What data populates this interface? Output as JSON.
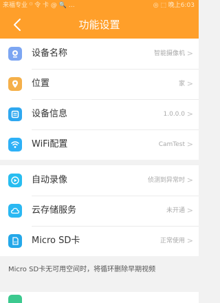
{
  "status_bar": {
    "left": "来福专业 ⁽⁾ 令 卡 @ 🔍 …",
    "right": "◎ ⬚ 晚上6:03"
  },
  "header": {
    "title": "功能设置"
  },
  "group1": {
    "items": [
      {
        "label": "设备名称",
        "value": "智能摄像机",
        "icon": "camera-icon",
        "color": "#7da6f2"
      },
      {
        "label": "位置",
        "value": "家",
        "icon": "location-pin-icon",
        "color": "#f5b04a"
      },
      {
        "label": "设备信息",
        "value": "1.0.0.0",
        "icon": "device-info-icon",
        "color": "#2fa8f0"
      },
      {
        "label": "WiFi配置",
        "value": "CamTest",
        "icon": "wifi-icon",
        "color": "#2eb1f7"
      }
    ]
  },
  "group2": {
    "items": [
      {
        "label": "自动录像",
        "value": "侦测到异常时",
        "icon": "record-icon",
        "color": "#28bdf0"
      },
      {
        "label": "云存储服务",
        "value": "未开通",
        "icon": "cloud-icon",
        "color": "#2ab8f2"
      },
      {
        "label": "Micro SD卡",
        "value": "正常使用",
        "icon": "sd-card-icon",
        "color": "#24a8e9"
      }
    ]
  },
  "note": "Micro SD卡无可用空间时，将循环删除早期视频",
  "chevron": ">"
}
